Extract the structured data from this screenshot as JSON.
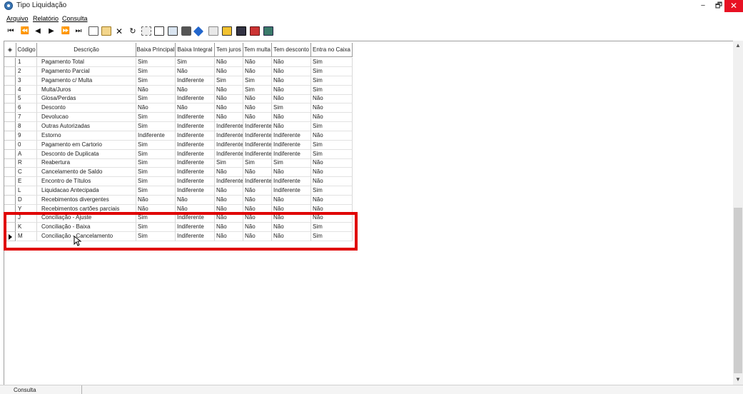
{
  "window": {
    "title": "Tipo Liquidação",
    "minimize_label": "−",
    "maximize_label": "🗗",
    "close_label": "✕"
  },
  "menu": [
    {
      "label": "Arquivo"
    },
    {
      "label": "Relatório"
    },
    {
      "label": "Consulta"
    }
  ],
  "toolbar": {
    "nav": [
      "⏮",
      "⏪",
      "◀",
      "▶",
      "⏩",
      "⏭"
    ],
    "icons": [
      "new-document-icon",
      "edit-icon",
      "delete-icon",
      "refresh-icon",
      "filter-icon",
      "preview-icon",
      "export-icon",
      "print-icon",
      "tag-icon",
      "clear-icon",
      "report-icon",
      "save-icon",
      "lock-icon",
      "tools-icon"
    ]
  },
  "grid": {
    "columns": [
      "Código",
      "Descrição",
      "Baixa Principal",
      "Baixa Integral",
      "Tem juros",
      "Tem multa",
      "Tem desconto",
      "Entra no Caixa"
    ],
    "rows": [
      [
        "1",
        "Pagamento Total",
        "Sim",
        "Sim",
        "Não",
        "Não",
        "Não",
        "Sim"
      ],
      [
        "2",
        "Pagamento Parcial",
        "Sim",
        "Não",
        "Não",
        "Não",
        "Não",
        "Sim"
      ],
      [
        "3",
        "Pagamento c/ Multa",
        "Sim",
        "Indiferente",
        "Sim",
        "Sim",
        "Não",
        "Sim"
      ],
      [
        "4",
        "Multa/Juros",
        "Não",
        "Não",
        "Não",
        "Sim",
        "Não",
        "Sim"
      ],
      [
        "5",
        "Glosa/Perdas",
        "Sim",
        "Indiferente",
        "Não",
        "Não",
        "Não",
        "Não"
      ],
      [
        "6",
        "Desconto",
        "Não",
        "Não",
        "Não",
        "Não",
        "Sim",
        "Não"
      ],
      [
        "7",
        "Devolucao",
        "Sim",
        "Indiferente",
        "Não",
        "Não",
        "Não",
        "Não"
      ],
      [
        "8",
        "Outras Autorizadas",
        "Sim",
        "Indiferente",
        "Indiferente",
        "Indiferente",
        "Não",
        "Sim"
      ],
      [
        "9",
        "Estorno",
        "Indiferente",
        "Indiferente",
        "Indiferente",
        "Indiferente",
        "Indiferente",
        "Não"
      ],
      [
        "0",
        "Pagamento em Cartorio",
        "Sim",
        "Indiferente",
        "Indiferente",
        "Indiferente",
        "Indiferente",
        "Sim"
      ],
      [
        "A",
        "Desconto de Duplicata",
        "Sim",
        "Indiferente",
        "Indiferente",
        "Indiferente",
        "Indiferente",
        "Sim"
      ],
      [
        "R",
        "Reabertura",
        "Sim",
        "Indiferente",
        "Sim",
        "Sim",
        "Sim",
        "Não"
      ],
      [
        "C",
        "Cancelamento de Saldo",
        "Sim",
        "Indiferente",
        "Não",
        "Não",
        "Não",
        "Não"
      ],
      [
        "E",
        "Encontro de Títulos",
        "Sim",
        "Indiferente",
        "Indiferente",
        "Indiferente",
        "Indiferente",
        "Não"
      ],
      [
        "L",
        "Liquidacao Antecipada",
        "Sim",
        "Indiferente",
        "Não",
        "Não",
        "Indiferente",
        "Sim"
      ],
      [
        "D",
        "Recebimentos divergentes",
        "Não",
        "Não",
        "Não",
        "Não",
        "Não",
        "Não"
      ],
      [
        "Y",
        "Recebimentos cartões parciais",
        "Não",
        "Não",
        "Não",
        "Não",
        "Não",
        "Não"
      ],
      [
        "J",
        "Conciliação - Ajuste",
        "Sim",
        "Indiferente",
        "Não",
        "Não",
        "Não",
        "Não"
      ],
      [
        "K",
        "Conciliação - Baixa",
        "Sim",
        "Indiferente",
        "Não",
        "Não",
        "Não",
        "Sim"
      ],
      [
        "M",
        "Conciliação - Cancelamento",
        "Sim",
        "Indiferente",
        "Não",
        "Não",
        "Não",
        "Sim"
      ]
    ],
    "current_row_index": 19
  },
  "highlight_color": "#e00000",
  "statusbar": {
    "tab_label": "Consulta"
  }
}
